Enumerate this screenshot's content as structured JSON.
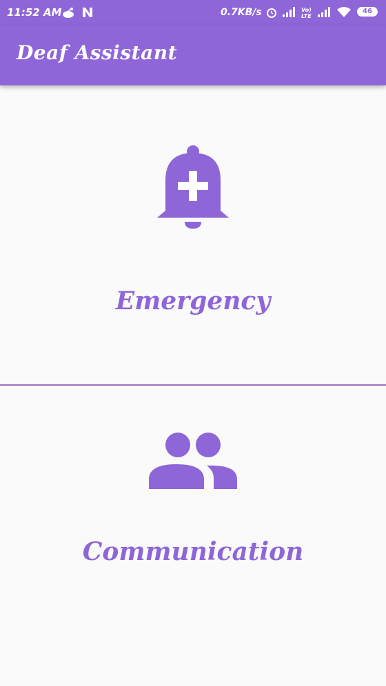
{
  "status_bar": {
    "time": "11:52 AM",
    "network_speed": "0.7KB/s",
    "battery": "46",
    "icons": [
      "notification-app-icon",
      "n-icon",
      "alarm-icon",
      "signal-icon",
      "volte-lte-icon",
      "signal-icon",
      "wifi-icon",
      "battery-icon"
    ]
  },
  "app_bar": {
    "title": "Deaf Assistant"
  },
  "cards": {
    "emergency": {
      "label": "Emergency",
      "icon": "emergency-bell-icon"
    },
    "communication": {
      "label": "Communication",
      "icon": "people-icon"
    }
  },
  "colors": {
    "primary": "#8e66d8",
    "background": "#fafafa",
    "divider": "#a070b8"
  }
}
